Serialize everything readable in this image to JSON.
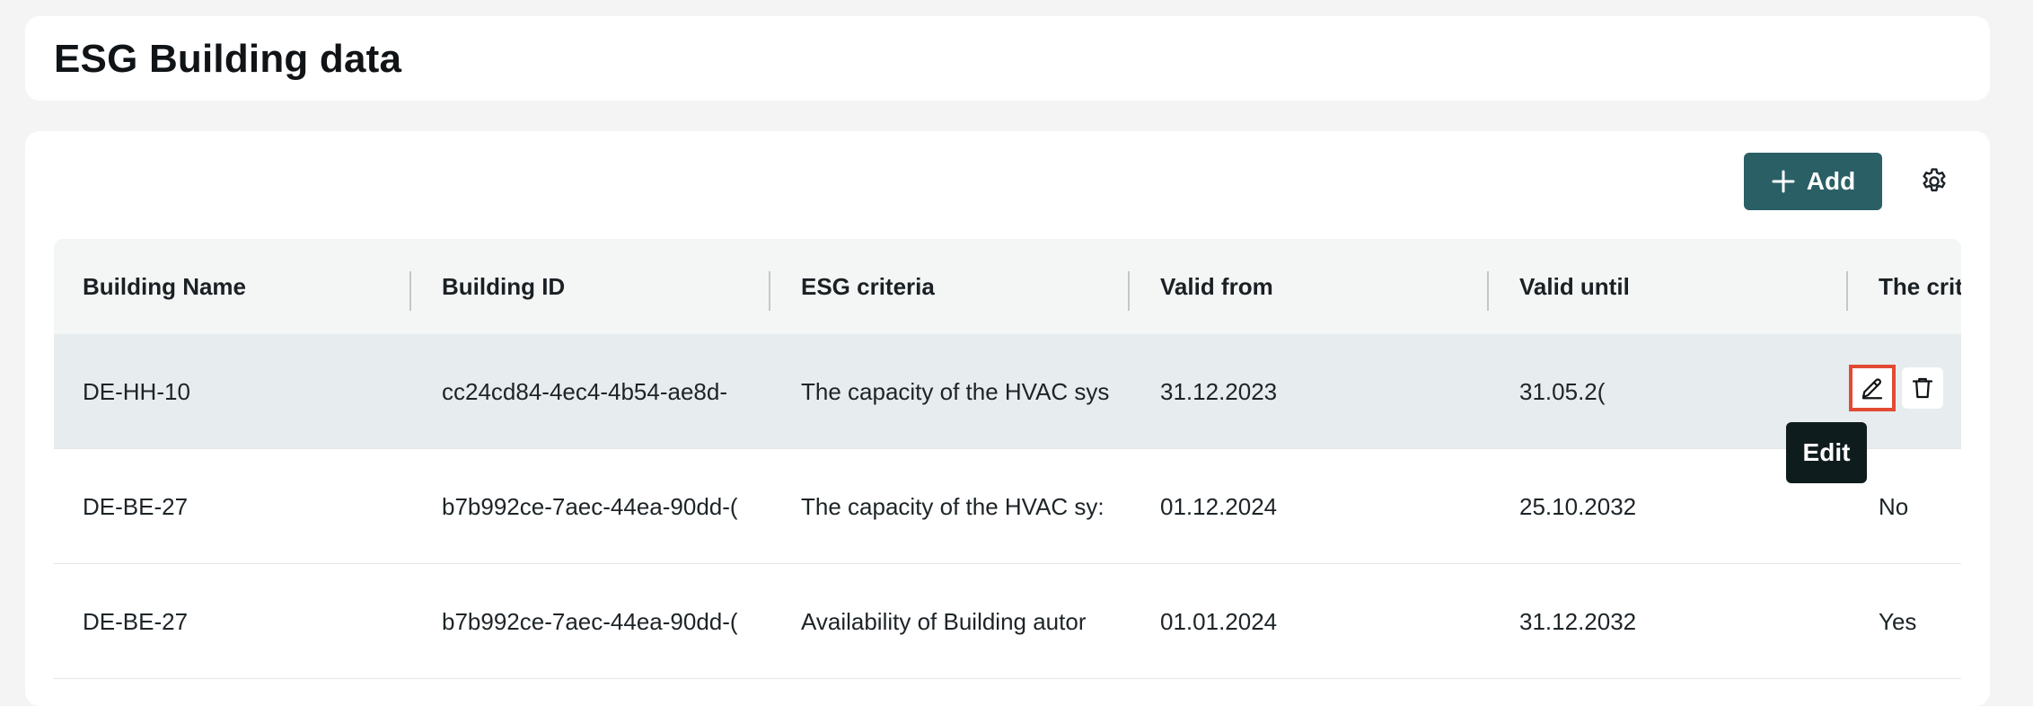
{
  "header": {
    "title": "ESG Building data"
  },
  "toolbar": {
    "add_label": "Add",
    "add_icon": "plus-icon",
    "settings_icon": "gear-icon",
    "accent_color": "#2a5f66"
  },
  "table": {
    "columns": [
      "Building Name",
      "Building ID",
      "ESG criteria",
      "Valid from",
      "Valid until",
      "The crit"
    ],
    "rows": [
      {
        "building_name": "DE-HH-10",
        "building_id": "cc24cd84-4ec4-4b54-ae8d-",
        "esg_criteria": "The capacity of the HVAC sys",
        "valid_from": "31.12.2023",
        "valid_until": "31.05.2(",
        "criteria_met": ""
      },
      {
        "building_name": "DE-BE-27",
        "building_id": "b7b992ce-7aec-44ea-90dd-(",
        "esg_criteria": "The capacity of the HVAC sy:",
        "valid_from": "01.12.2024",
        "valid_until": "25.10.2032",
        "criteria_met": "No"
      },
      {
        "building_name": "DE-BE-27",
        "building_id": "b7b992ce-7aec-44ea-90dd-(",
        "esg_criteria": "Availability of Building autor",
        "valid_from": "01.01.2024",
        "valid_until": "31.12.2032",
        "criteria_met": "Yes"
      }
    ],
    "row_actions": {
      "edit_icon": "pencil-icon",
      "delete_icon": "trash-icon"
    }
  },
  "tooltip": {
    "text": "Edit"
  }
}
